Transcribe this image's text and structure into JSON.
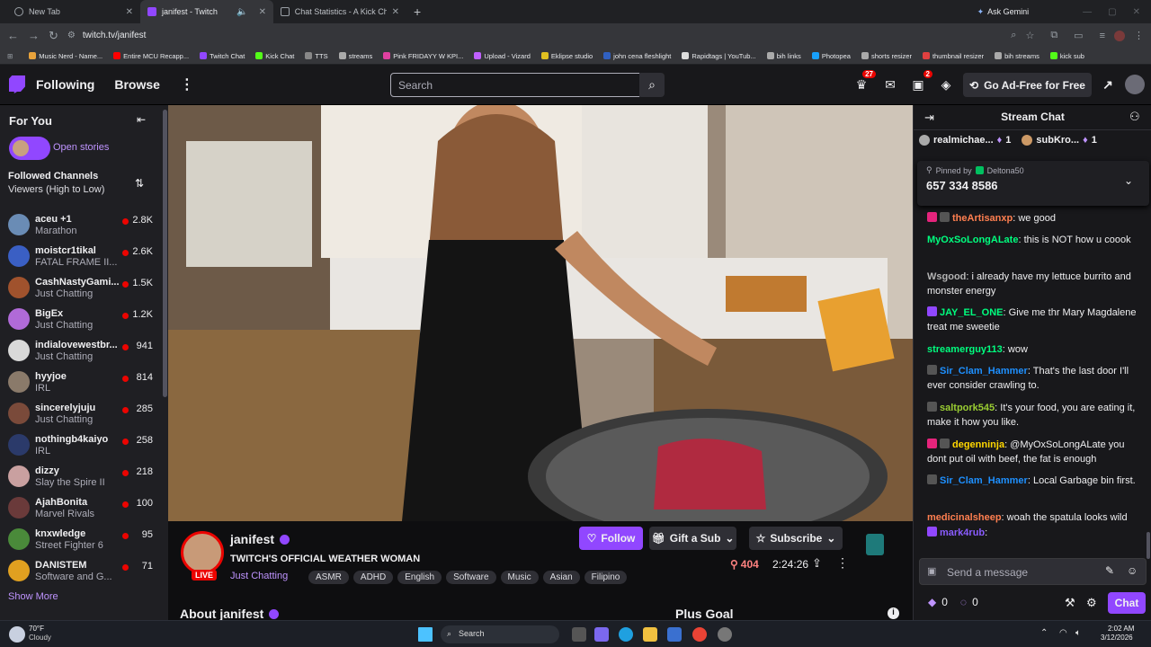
{
  "browser": {
    "tabs": [
      {
        "title": "New Tab",
        "active": false
      },
      {
        "title": "janifest - Twitch",
        "active": true
      },
      {
        "title": "Chat Statistics - A Kick Chat An",
        "active": false
      }
    ],
    "url": "twitch.tv/janifest",
    "profile_button": "Ask Gemini",
    "bookmarks": [
      "Music Nerd - Name...",
      "Entire MCU Recapp...",
      "Twitch Chat",
      "Kick Chat",
      "TTS",
      "streams",
      "Pink FRIDAYY W KPI...",
      "Upload - Vizard",
      "Eklipse studio",
      "john cena fleshlight",
      "Rapidtags | YouTub...",
      "bih links",
      "Photopea",
      "shorts resizer",
      "thumbnail resizer",
      "bih streams",
      "kick sub"
    ]
  },
  "topnav": {
    "following": "Following",
    "browse": "Browse",
    "search_placeholder": "Search",
    "inbox_badge": "27",
    "notif_badge": "2",
    "adfree": "Go Ad-Free for Free"
  },
  "sidebar": {
    "for_you": "For You",
    "open_stories": "Open stories",
    "followed_title": "Followed Channels",
    "followed_sort": "Viewers (High to Low)",
    "show_more": "Show More",
    "channels": [
      {
        "name": "aceu +1",
        "category": "Marathon",
        "viewers": "2.8K",
        "color": "#6a8cb5"
      },
      {
        "name": "moistcr1tikal",
        "category": "FATAL FRAME II...",
        "viewers": "2.6K",
        "color": "#3a5fc4"
      },
      {
        "name": "CashNastyGami...",
        "category": "Just Chatting",
        "viewers": "1.5K",
        "color": "#a0522d"
      },
      {
        "name": "BigEx",
        "category": "Just Chatting",
        "viewers": "1.2K",
        "color": "#b06ad8"
      },
      {
        "name": "indialovewestbr...",
        "category": "Just Chatting",
        "viewers": "941",
        "color": "#d9d9d9"
      },
      {
        "name": "hyyjoe",
        "category": "IRL",
        "viewers": "814",
        "color": "#8a7a6a"
      },
      {
        "name": "sincerelyjuju",
        "category": "Just Chatting",
        "viewers": "285",
        "color": "#7a4a3a"
      },
      {
        "name": "nothingb4kaiyo",
        "category": "IRL",
        "viewers": "258",
        "color": "#2b3a6a"
      },
      {
        "name": "dizzy",
        "category": "Slay the Spire II",
        "viewers": "218",
        "color": "#c9a0a0"
      },
      {
        "name": "AjahBonita",
        "category": "Marvel Rivals",
        "viewers": "100",
        "color": "#6a3a3a"
      },
      {
        "name": "knxwledge",
        "category": "Street Fighter 6",
        "viewers": "95",
        "color": "#4a8a3a"
      },
      {
        "name": "DANISTEM",
        "category": "Software and G...",
        "viewers": "71",
        "color": "#e0a020"
      }
    ]
  },
  "channel": {
    "name": "janifest",
    "title": "TWITCH'S OFFICIAL WEATHER WOMAN",
    "live": "LIVE",
    "category": "Just Chatting",
    "tags": [
      "ASMR",
      "ADHD",
      "English",
      "Software",
      "Music",
      "Asian",
      "Filipino"
    ],
    "viewers": "404",
    "uptime": "2:24:26",
    "follow": "Follow",
    "gift": "Gift a Sub",
    "subscribe": "Subscribe",
    "about": "About janifest",
    "plus_goal": "Plus Goal"
  },
  "chat": {
    "title": "Stream Chat",
    "leaders": [
      {
        "name": "realmichae...",
        "count": "1"
      },
      {
        "name": "subKro...",
        "count": "1"
      }
    ],
    "pinned_by": "Pinned by",
    "pinned_user": "Deltona50",
    "pinned_text": "657 334 8586",
    "messages": [
      {
        "user": "theArtisanxp",
        "text": ": we good",
        "color": "#ff7f50"
      },
      {
        "user": "MyOxSoLongALate",
        "text": ": this is NOT how u coook",
        "color": "#00ff7f"
      },
      {
        "user": "Wsgood",
        "text": ": i already have my lettuce burrito and monster energy",
        "color": "#b4b4b4"
      },
      {
        "user": "JAY_EL_ONE",
        "text": ": Give me thr Mary Magdalene treat me sweetie",
        "color": "#00ff7f"
      },
      {
        "user": "streamerguy113",
        "text": ": wow",
        "color": "#00ff7f"
      },
      {
        "user": "Sir_Clam_Hammer",
        "text": ": That's the last door I'll ever consider crawling to.",
        "color": "#1e90ff"
      },
      {
        "user": "saltpork545",
        "text": ": It's your food, you are eating it, make it how you like.",
        "color": "#9acd32"
      },
      {
        "user": "degenninja",
        "text": ": @MyOxSoLongALate you dont put oil with beef, the fat is enough",
        "color": "#ffd700"
      },
      {
        "user": "Sir_Clam_Hammer",
        "text": ": Local Garbage bin first.",
        "color": "#1e90ff"
      },
      {
        "user": "medicinalsheep",
        "text": ": woah the spatula looks wild",
        "color": "#ff7f50"
      },
      {
        "user": "mark4rub",
        "text": ":",
        "color": "#8a5cff"
      }
    ],
    "input_placeholder": "Send a message",
    "points_a": "0",
    "points_b": "0",
    "chat_button": "Chat"
  },
  "taskbar": {
    "temp": "70°F",
    "weather": "Cloudy",
    "search": "Search",
    "time": "2:02 AM",
    "date": "3/12/2026"
  },
  "colors": {
    "accent": "#9147ff",
    "live": "#eb0400"
  }
}
